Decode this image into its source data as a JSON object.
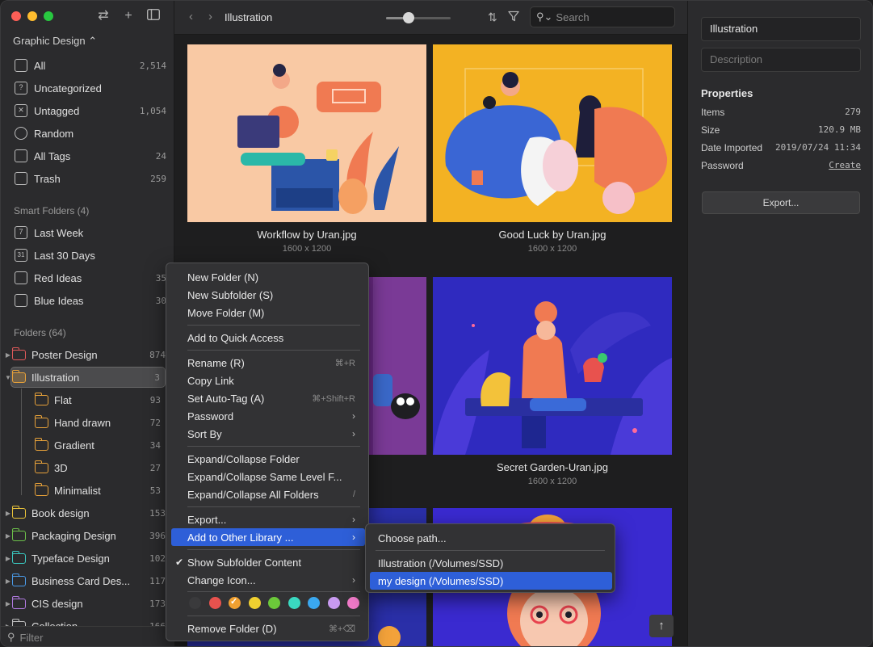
{
  "library": {
    "name": "Graphic Design"
  },
  "sidebar": {
    "items": [
      {
        "label": "All",
        "count": "2,514",
        "icon": "all-icon"
      },
      {
        "label": "Uncategorized",
        "count": "",
        "icon": "uncategorized-icon"
      },
      {
        "label": "Untagged",
        "count": "1,054",
        "icon": "untagged-icon"
      },
      {
        "label": "Random",
        "count": "",
        "icon": "random-icon"
      },
      {
        "label": "All Tags",
        "count": "24",
        "icon": "tag-icon"
      },
      {
        "label": "Trash",
        "count": "259",
        "icon": "trash-icon"
      }
    ],
    "smart_title": "Smart Folders (4)",
    "smart_folders": [
      {
        "label": "Last Week",
        "count": "",
        "icon_text": "7"
      },
      {
        "label": "Last 30 Days",
        "count": "",
        "icon_text": "31"
      },
      {
        "label": "Red Ideas",
        "count": "35",
        "icon_text": ""
      },
      {
        "label": "Blue Ideas",
        "count": "30",
        "icon_text": ""
      }
    ],
    "folders_title": "Folders (64)",
    "folders": [
      {
        "label": "Poster Design",
        "count": "874",
        "color": "#e05a5a"
      },
      {
        "label": "Illustration",
        "count": "3",
        "color": "#e8a23a"
      },
      {
        "label": "Flat",
        "count": "93",
        "color": "#e8a23a"
      },
      {
        "label": "Hand drawn",
        "count": "72",
        "color": "#e8a23a"
      },
      {
        "label": "Gradient",
        "count": "34",
        "color": "#e8a23a"
      },
      {
        "label": "3D",
        "count": "27",
        "color": "#e8a23a"
      },
      {
        "label": "Minimalist",
        "count": "53",
        "color": "#e8a23a"
      },
      {
        "label": "Book design",
        "count": "153",
        "color": "#e8c23a"
      },
      {
        "label": "Packaging Design",
        "count": "396",
        "color": "#6cc04a"
      },
      {
        "label": "Typeface Design",
        "count": "102",
        "color": "#3ac8c0"
      },
      {
        "label": "Business Card Des...",
        "count": "117",
        "color": "#4a9ae8"
      },
      {
        "label": "CIS design",
        "count": "173",
        "color": "#b07ae0"
      },
      {
        "label": "Collection",
        "count": "166",
        "color": "#c0c0c0"
      }
    ],
    "filter_placeholder": "Filter"
  },
  "toolbar": {
    "breadcrumb": "Illustration",
    "search_placeholder": "Search",
    "zoom_level": 0.35
  },
  "grid": {
    "items": [
      {
        "name": "Workflow by Uran.jpg",
        "dims": "1600 x 1200"
      },
      {
        "name": "Good Luck by Uran.jpg",
        "dims": "1600 x 1200"
      },
      {
        "name": "",
        "dims": ""
      },
      {
        "name": "Secret Garden-Uran.jpg",
        "dims": "1600 x 1200"
      }
    ]
  },
  "inspector": {
    "title_value": "Illustration",
    "description_placeholder": "Description",
    "properties_title": "Properties",
    "properties": [
      {
        "label": "Items",
        "value": "279"
      },
      {
        "label": "Size",
        "value": "120.9 MB"
      },
      {
        "label": "Date Imported",
        "value": "2019/07/24 11:34"
      },
      {
        "label": "Password",
        "value": "Create"
      }
    ],
    "export_label": "Export..."
  },
  "context_menu": {
    "items": [
      {
        "label": "New Folder (N)",
        "shortcut": ""
      },
      {
        "label": "New Subfolder (S)",
        "shortcut": ""
      },
      {
        "label": "Move Folder (M)",
        "shortcut": ""
      },
      {
        "label": "Add to Quick Access",
        "shortcut": ""
      },
      {
        "label": "Rename (R)",
        "shortcut": "⌘+R"
      },
      {
        "label": "Copy Link",
        "shortcut": ""
      },
      {
        "label": "Set Auto-Tag (A)",
        "shortcut": "⌘+Shift+R"
      },
      {
        "label": "Password",
        "shortcut": ""
      },
      {
        "label": "Sort By",
        "shortcut": ""
      },
      {
        "label": "Expand/Collapse Folder",
        "shortcut": ""
      },
      {
        "label": "Expand/Collapse Same Level F...",
        "shortcut": ""
      },
      {
        "label": "Expand/Collapse All Folders",
        "shortcut": "/"
      },
      {
        "label": "Export...",
        "shortcut": ""
      },
      {
        "label": "Add to Other Library ...",
        "shortcut": ""
      },
      {
        "label": "Show Subfolder Content",
        "shortcut": ""
      },
      {
        "label": "Change Icon...",
        "shortcut": ""
      },
      {
        "label": "Remove Folder (D)",
        "shortcut": "⌘+⌫"
      }
    ],
    "colors": [
      "#3a3a3c",
      "#e8524e",
      "#f0a030",
      "#f0d030",
      "#6cc83a",
      "#3ad8c0",
      "#3aa8f0",
      "#c89af0",
      "#f07ac8"
    ]
  },
  "submenu": {
    "items": [
      {
        "label": "Choose path..."
      },
      {
        "label": "Illustration (/Volumes/SSD)"
      },
      {
        "label": "my design (/Volumes/SSD)"
      }
    ]
  }
}
